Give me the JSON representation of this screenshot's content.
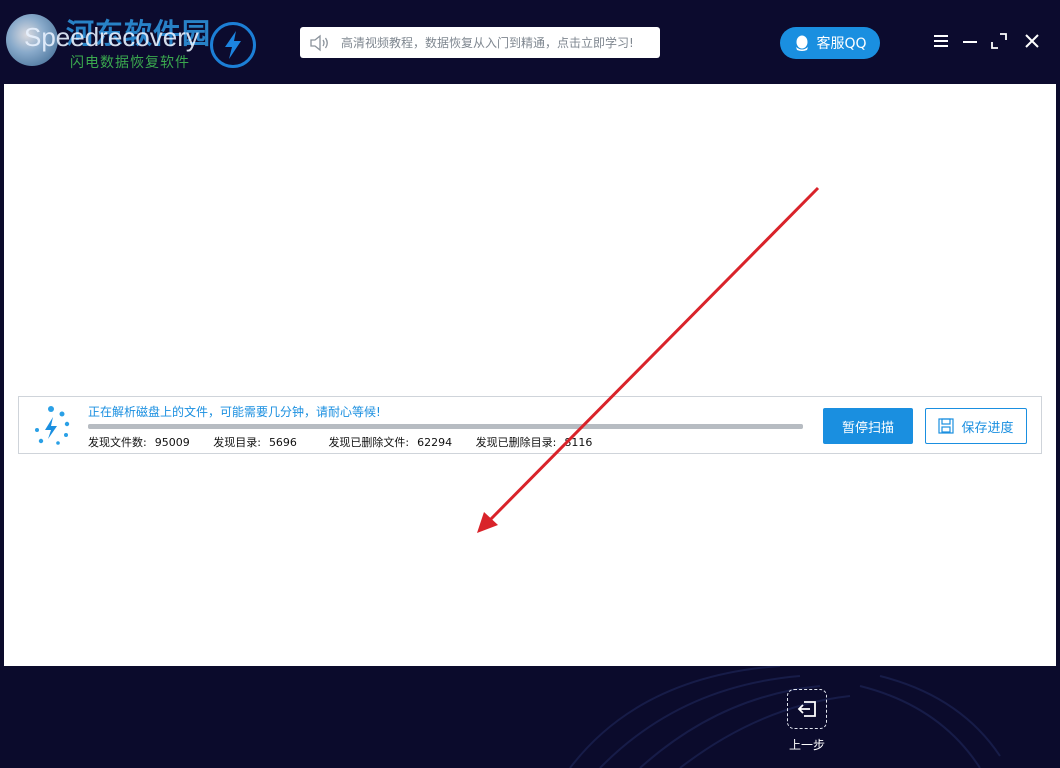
{
  "header": {
    "logo_watermark": "河东软件园",
    "logo_name": "Speedrecovery",
    "logo_subtitle": "闪电数据恢复软件",
    "tip_text": "高清视频教程，数据恢复从入门到精通，点击立即学习!",
    "qq_label": "客服QQ"
  },
  "window_controls": [
    "menu-icon",
    "minimize-icon",
    "maximize-icon",
    "close-icon"
  ],
  "scan": {
    "status": "正在解析磁盘上的文件，可能需要几分钟，请耐心等候!",
    "progress": 1.0,
    "stats": {
      "files_label": "发现文件数:",
      "files_value": "95009",
      "dirs_label": "发现目录:",
      "dirs_value": "5696",
      "deleted_files_label": "发现已删除文件:",
      "deleted_files_value": "62294",
      "deleted_dirs_label": "发现已删除目录:",
      "deleted_dirs_value": "8116"
    },
    "pause_label": "暂停扫描",
    "save_label": "保存进度"
  },
  "footer": {
    "back_label": "上一步"
  },
  "colors": {
    "accent": "#1a8fe0",
    "titlebar": "#0c0b2e",
    "annotation_arrow": "#d9232a"
  }
}
